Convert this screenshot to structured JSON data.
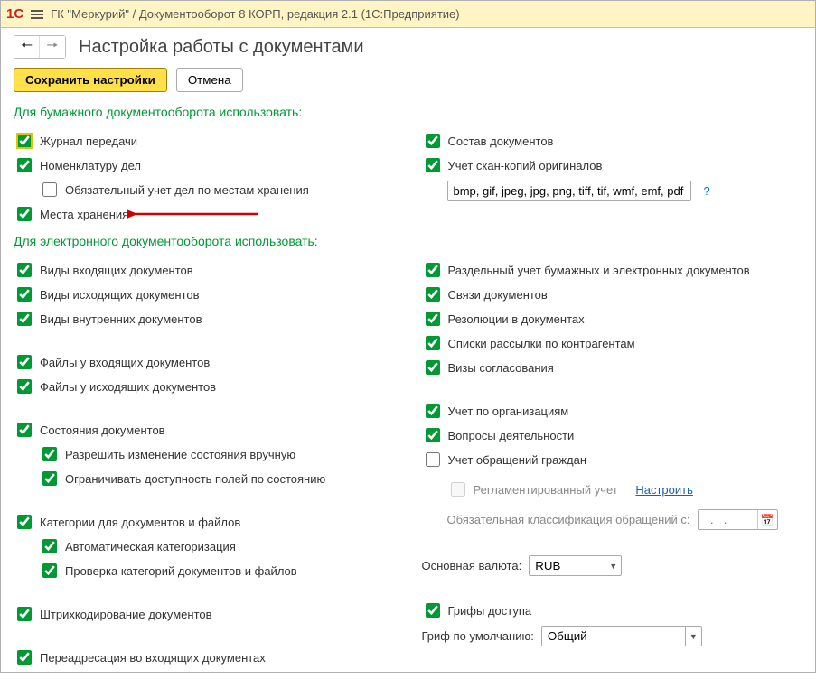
{
  "header": {
    "title": "ГК \"Меркурий\" / Документооборот 8 КОРП, редакция 2.1  (1С:Предприятие)",
    "logo": "1С"
  },
  "main_title": "Настройка работы с документами",
  "buttons": {
    "save": "Сохранить настройки",
    "cancel": "Отмена"
  },
  "sections": {
    "paper": "Для бумажного документооборота использовать:",
    "electronic": "Для электронного документооборота использовать:"
  },
  "paper": {
    "left": {
      "journal": "Журнал передачи",
      "nomenclature": "Номенклатуру дел",
      "mandatory": "Обязательный учет дел по местам хранения",
      "storage": "Места хранения"
    },
    "right": {
      "composition": "Состав документов",
      "scan": "Учет скан-копий оригиналов",
      "formats": "bmp, gif, jpeg, jpg, png, tiff, tif, wmf, emf, pdf",
      "help": "?"
    }
  },
  "electronic": {
    "left": {
      "incoming": "Виды входящих документов",
      "outgoing": "Виды исходящих документов",
      "internal": "Виды внутренних документов",
      "files_in": "Файлы у входящих документов",
      "files_out": "Файлы у исходящих документов",
      "states": "Состояния документов",
      "allow_manual": "Разрешить изменение состояния вручную",
      "limit_fields": "Ограничивать доступность полей по состоянию",
      "categories": "Категории для документов и файлов",
      "auto_cat": "Автоматическая категоризация",
      "check_cat": "Проверка категорий документов и файлов",
      "barcode": "Штрихкодирование документов",
      "redirect": "Переадресация во входящих документах"
    },
    "right": {
      "separate": "Раздельный учет бумажных и электронных документов",
      "links": "Связи документов",
      "resolutions": "Резолюции в документах",
      "mailing": "Списки рассылки по контрагентам",
      "approval": "Визы согласования",
      "by_org": "Учет по организациям",
      "activities": "Вопросы деятельности",
      "citizens": "Учет обращений граждан",
      "regulated": "Регламентированный учет",
      "configure": "Настроить",
      "classification": "Обязательная классификация обращений с:",
      "date_placeholder": "  .   .    ",
      "currency_label": "Основная валюта:",
      "currency_value": "RUB",
      "stamps": "Грифы доступа",
      "stamp_default_label": "Гриф по умолчанию:",
      "stamp_default_value": "Общий"
    }
  }
}
